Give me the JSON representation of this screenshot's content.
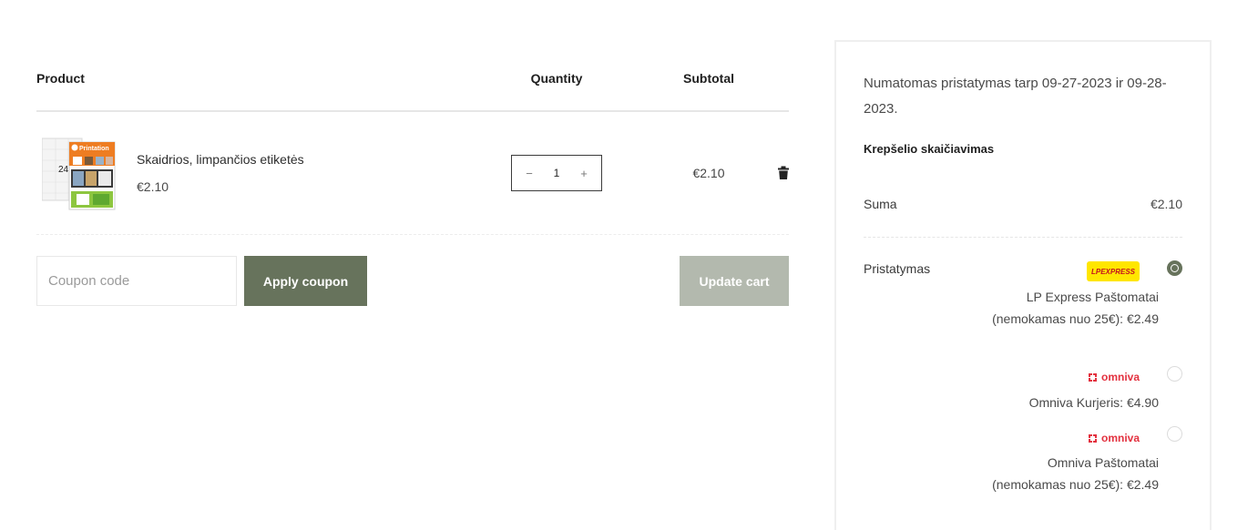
{
  "cart": {
    "headers": {
      "product": "Product",
      "quantity": "Quantity",
      "subtotal": "Subtotal"
    },
    "item": {
      "name": "Skaidrios, limpančios etiketės",
      "price": "€2.10",
      "quantity": "1",
      "subtotal": "€2.10",
      "thumb_brand": "Printation",
      "thumb_count": "24"
    },
    "coupon_placeholder": "Coupon code",
    "apply_label": "Apply coupon",
    "update_label": "Update cart"
  },
  "totals": {
    "delivery_note": "Numatomas pristatymas tarp 09-27-2023 ir 09-28-2023.",
    "calc_title": "Krepšelio skaičiavimas",
    "suma_label": "Suma",
    "suma_value": "€2.10",
    "shipping_label": "Pristatymas",
    "shipping_options": [
      {
        "logo": "LPEXPRESS",
        "text": "LP Express Paštomatai (nemokamas nuo 25€): €2.49",
        "selected": true
      },
      {
        "logo": "omniva",
        "text": "Omniva Kurjeris: €4.90",
        "selected": false
      },
      {
        "logo": "omniva",
        "text": "Omniva Paštomatai (nemokamas nuo 25€): €2.49",
        "selected": false
      }
    ]
  },
  "colors": {
    "accent": "#67735c",
    "update_disabled": "#b3b9ae",
    "lp_yellow": "#ffe600",
    "omniva_red": "#e3313f"
  },
  "icons": {
    "minus": "minus-icon",
    "plus": "plus-icon",
    "trash": "trash-icon",
    "radio_selected": "radio-checked-icon",
    "radio_unselected": "radio-unchecked-icon"
  }
}
